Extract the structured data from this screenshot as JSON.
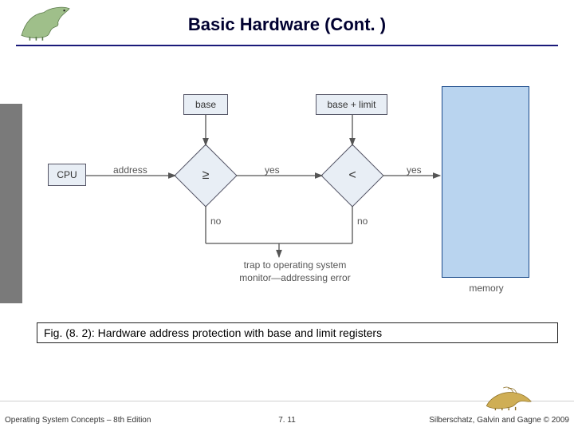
{
  "header": {
    "title": "Basic Hardware (Cont. )"
  },
  "diagram": {
    "cpu": "CPU",
    "base": "base",
    "base_plus_limit": "base + limit",
    "memory": "memory",
    "cmp_ge": "≥",
    "cmp_lt": "<",
    "edge_address": "address",
    "edge_yes1": "yes",
    "edge_yes2": "yes",
    "edge_no1": "no",
    "edge_no2": "no",
    "trap_line1": "trap to operating system",
    "trap_line2": "monitor—addressing error"
  },
  "caption": "Fig. (8. 2): Hardware address protection with base and limit registers",
  "footer": {
    "left": "Operating System Concepts – 8th Edition",
    "center": "7. 11",
    "right": "Silberschatz, Galvin and Gagne © 2009"
  }
}
